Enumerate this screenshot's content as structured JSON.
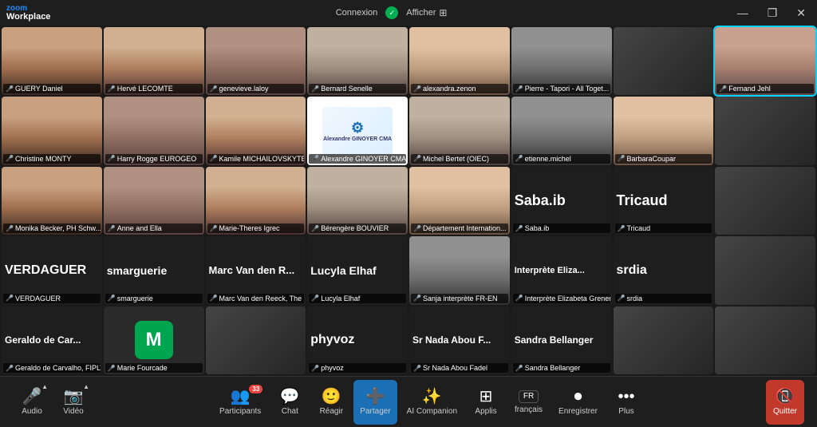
{
  "app": {
    "name": "zoom",
    "subtitle": "Workplace"
  },
  "titlebar": {
    "connection": "Connexion",
    "view": "Afficher",
    "minimize": "—",
    "restore": "❐",
    "close": "✕"
  },
  "participants": [
    {
      "name": "GUERY Daniel",
      "mic": true,
      "cam": true,
      "bg": "human-bg-1"
    },
    {
      "name": "Hervé LECOMTE",
      "mic": true,
      "cam": true,
      "bg": "human-bg-2"
    },
    {
      "name": "genevieve.laloy",
      "mic": false,
      "cam": true,
      "bg": "human-bg-3"
    },
    {
      "name": "Bernard Senelle",
      "mic": true,
      "cam": true,
      "bg": "human-bg-4"
    },
    {
      "name": "alexandra.zenon",
      "mic": true,
      "cam": true,
      "bg": "human-bg-5"
    },
    {
      "name": "Pierre - Tapori - All Toget...",
      "mic": true,
      "cam": true,
      "bg": "human-bg-6"
    },
    {
      "name": "Fernand Jehl",
      "mic": false,
      "cam": true,
      "active": true,
      "bg": "human-bg-7"
    },
    {
      "name": "Christine MONTY",
      "mic": false,
      "cam": true,
      "bg": "human-bg-1"
    },
    {
      "name": "Harry Rogge EUROGEO",
      "mic": false,
      "cam": true,
      "bg": "human-bg-3"
    },
    {
      "name": "Kamile MICHAILOVSKYTE",
      "mic": false,
      "cam": true,
      "bg": "human-bg-2"
    },
    {
      "name": "Alexandre GINOYER CMA",
      "mic": false,
      "cam": false,
      "logo": true
    },
    {
      "name": "Michel Bertet (OIEC)",
      "mic": false,
      "cam": true,
      "bg": "human-bg-4"
    },
    {
      "name": "etienne.michel",
      "mic": false,
      "cam": true,
      "bg": "human-bg-6"
    },
    {
      "name": "BarbaraCoupar",
      "mic": false,
      "cam": true,
      "bg": "human-bg-5"
    },
    {
      "name": "Monika Becker, PH Schw...",
      "mic": false,
      "cam": true,
      "bg": "human-bg-1"
    },
    {
      "name": "Anne and Ella",
      "mic": false,
      "cam": true,
      "bg": "human-bg-3"
    },
    {
      "name": "Marie-Theres Igrec",
      "mic": false,
      "cam": true,
      "bg": "human-bg-2"
    },
    {
      "name": "Bérengère BOUVIER",
      "mic": false,
      "cam": true,
      "bg": "human-bg-4"
    },
    {
      "name": "Département Internation...",
      "mic": false,
      "cam": true,
      "bg": "human-bg-5"
    },
    {
      "name": "Saba.ib",
      "mic": false,
      "cam": false,
      "nameOnly": true,
      "largeName": "Saba.ib"
    },
    {
      "name": "Tricaud",
      "mic": false,
      "cam": false,
      "nameOnly": true,
      "largeName": "Tricaud"
    },
    {
      "name": "VERDAGUER",
      "mic": false,
      "cam": false,
      "nameOnly": true,
      "largeName": "VERDAGUER"
    },
    {
      "name": "smarguerie",
      "mic": false,
      "cam": false,
      "nameOnly": true,
      "largeName": "smarguerie"
    },
    {
      "name": "Marc Van den Reeck, The ...",
      "mic": false,
      "cam": false,
      "nameOnly": true,
      "largeName": "Marc Van den R..."
    },
    {
      "name": "Lucyla Elhaf",
      "mic": false,
      "cam": false,
      "nameOnly": true,
      "largeName": "Lucyla Elhaf"
    },
    {
      "name": "Sanja interprète FR-EN",
      "mic": false,
      "cam": true,
      "bg": "human-bg-6"
    },
    {
      "name": "Interprète Elizabeta Greneron",
      "mic": false,
      "cam": false,
      "nameOnly": true,
      "largeName": "Interprète Eliza..."
    },
    {
      "name": "srdia",
      "mic": false,
      "cam": false,
      "nameOnly": true,
      "largeName": "srdia"
    },
    {
      "name": "Geraldo de Carvalho, FIPLV",
      "mic": false,
      "cam": false,
      "nameOnly": true,
      "largeName": "Geraldo de Car..."
    },
    {
      "name": "Marie Fourcade",
      "mic": false,
      "cam": false,
      "mTile": true
    },
    {
      "name": "phyvoz",
      "mic": false,
      "cam": false,
      "nameOnly": true,
      "largeName": "phyvoz"
    },
    {
      "name": "Sr Nada Abou Fadel",
      "mic": false,
      "cam": false,
      "nameOnly": true,
      "largeName": "Sr Nada Abou F..."
    },
    {
      "name": "Sandra Bellanger",
      "mic": false,
      "cam": false,
      "nameOnly": true,
      "largeName": "Sandra Bellanger"
    }
  ],
  "toolbar": {
    "audio_label": "Audio",
    "video_label": "Vidéo",
    "participants_label": "Participants",
    "participants_count": "33",
    "chat_label": "Chat",
    "react_label": "Réagir",
    "share_label": "Partager",
    "ai_label": "AI Companion",
    "apps_label": "Applis",
    "language_label": "français",
    "language_code": "FR",
    "record_label": "Enregistrer",
    "more_label": "Plus",
    "leave_label": "Quitter"
  }
}
